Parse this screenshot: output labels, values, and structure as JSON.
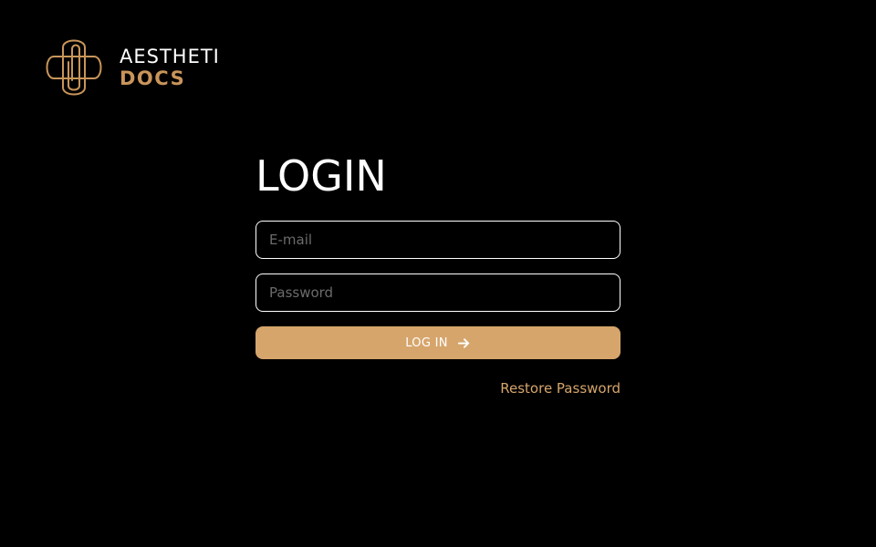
{
  "brand": {
    "line1": "AESTHETI",
    "line2": "DOCS",
    "accent_color": "#c9955a",
    "logo_icon": "paperclip-logo-icon"
  },
  "login": {
    "title": "LOGIN",
    "email_placeholder": "E-mail",
    "email_value": "",
    "password_placeholder": "Password",
    "password_value": "",
    "button_label": "LOG IN",
    "button_icon": "arrow-right-icon",
    "button_color": "#d6a56c",
    "restore_label": "Restore Password"
  },
  "colors": {
    "background": "#000000",
    "text": "#ffffff",
    "placeholder": "#6b6b6b"
  }
}
